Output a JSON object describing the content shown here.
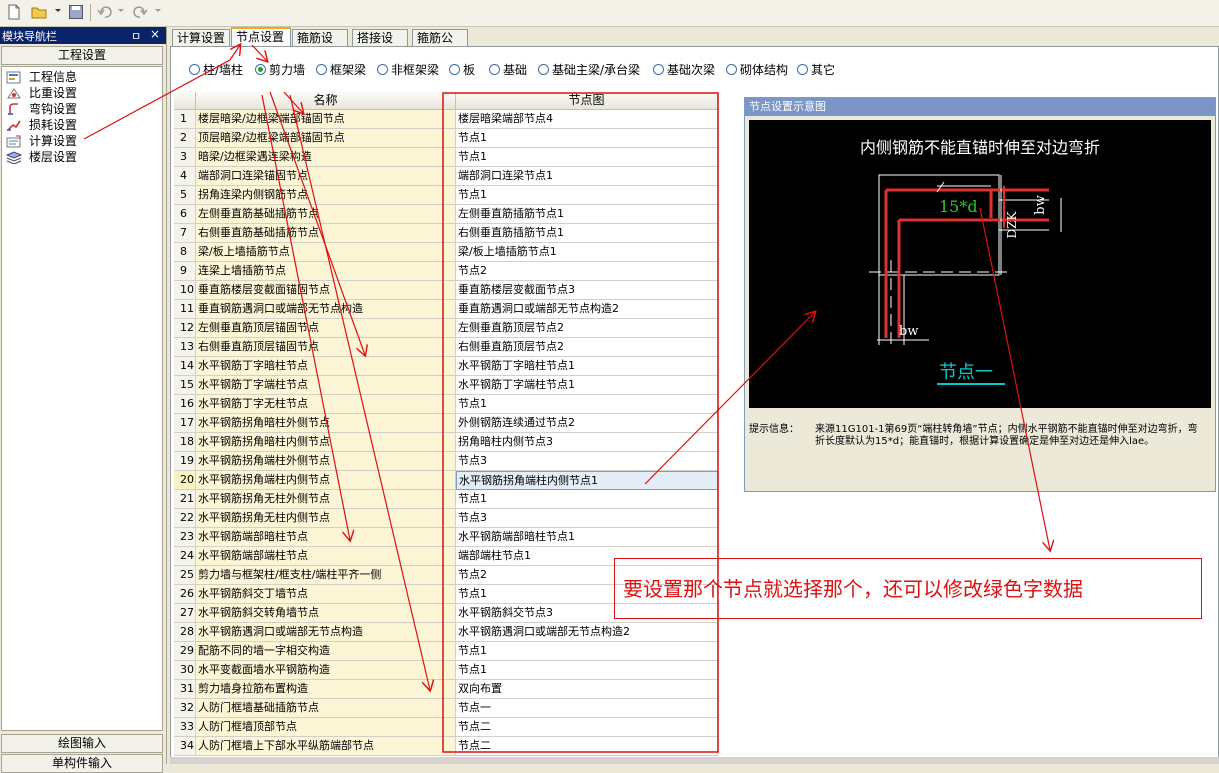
{
  "toolbar": {
    "icons": [
      "new-file-icon",
      "open-folder-icon",
      "save-icon",
      "undo-icon",
      "redo-icon"
    ]
  },
  "nav": {
    "title": "模块导航栏",
    "pin": "ㅁ",
    "close": "×",
    "top_button": "工程设置",
    "items": [
      {
        "label": "工程信息",
        "icon": "info-icon"
      },
      {
        "label": "比重设置",
        "icon": "weight-icon"
      },
      {
        "label": "弯钩设置",
        "icon": "hook-icon"
      },
      {
        "label": "损耗设置",
        "icon": "loss-icon"
      },
      {
        "label": "计算设置",
        "icon": "calc-icon"
      },
      {
        "label": "楼层设置",
        "icon": "floor-icon"
      }
    ],
    "bottom_button_1": "绘图输入",
    "bottom_button_2": "单构件输入"
  },
  "tabs": [
    {
      "label": "计算设置",
      "active": false
    },
    {
      "label": "节点设置",
      "active": true
    },
    {
      "label": "箍筋设置",
      "active": false
    },
    {
      "label": "搭接设置",
      "active": false
    },
    {
      "label": "箍筋公式",
      "active": false
    }
  ],
  "categories": [
    {
      "label": "柱/墙柱",
      "selected": false
    },
    {
      "label": "剪力墙",
      "selected": true
    },
    {
      "label": "框架梁",
      "selected": false
    },
    {
      "label": "非框架梁",
      "selected": false
    },
    {
      "label": "板",
      "selected": false
    },
    {
      "label": "基础",
      "selected": false
    },
    {
      "label": "基础主梁/承台梁",
      "selected": false
    },
    {
      "label": "基础次梁",
      "selected": false
    },
    {
      "label": "砌体结构",
      "selected": false
    },
    {
      "label": "其它",
      "selected": false
    }
  ],
  "grid": {
    "col_name": "名称",
    "col_node": "节点图",
    "selected_row": 20,
    "rows": [
      {
        "idx": "1",
        "name": "楼层暗梁/边框梁端部锚固节点",
        "node": "楼层暗梁端部节点4"
      },
      {
        "idx": "2",
        "name": "顶层暗梁/边框梁端部锚固节点",
        "node": "节点1"
      },
      {
        "idx": "3",
        "name": "暗梁/边框梁遇连梁构造",
        "node": "节点1"
      },
      {
        "idx": "4",
        "name": "端部洞口连梁锚固节点",
        "node": "端部洞口连梁节点1"
      },
      {
        "idx": "5",
        "name": "拐角连梁内侧钢筋节点",
        "node": "节点1"
      },
      {
        "idx": "6",
        "name": "左侧垂直筋基础插筋节点",
        "node": "左侧垂直筋插筋节点1"
      },
      {
        "idx": "7",
        "name": "右侧垂直筋基础插筋节点",
        "node": "右侧垂直筋插筋节点1"
      },
      {
        "idx": "8",
        "name": "梁/板上墙插筋节点",
        "node": "梁/板上墙插筋节点1"
      },
      {
        "idx": "9",
        "name": "连梁上墙插筋节点",
        "node": "节点2"
      },
      {
        "idx": "10",
        "name": "垂直筋楼层变截面锚固节点",
        "node": "垂直筋楼层变截面节点3"
      },
      {
        "idx": "11",
        "name": "垂直钢筋遇洞口或端部无节点构造",
        "node": "垂直筋遇洞口或端部无节点构造2"
      },
      {
        "idx": "12",
        "name": "左侧垂直筋顶层锚固节点",
        "node": "左侧垂直筋顶层节点2"
      },
      {
        "idx": "13",
        "name": "右侧垂直筋顶层锚固节点",
        "node": "右侧垂直筋顶层节点2"
      },
      {
        "idx": "14",
        "name": "水平钢筋丁字暗柱节点",
        "node": "水平钢筋丁字暗柱节点1"
      },
      {
        "idx": "15",
        "name": "水平钢筋丁字端柱节点",
        "node": "水平钢筋丁字端柱节点1"
      },
      {
        "idx": "16",
        "name": "水平钢筋丁字无柱节点",
        "node": "节点1"
      },
      {
        "idx": "17",
        "name": "水平钢筋拐角暗柱外侧节点",
        "node": "外侧钢筋连续通过节点2"
      },
      {
        "idx": "18",
        "name": "水平钢筋拐角暗柱内侧节点",
        "node": "拐角暗柱内侧节点3"
      },
      {
        "idx": "19",
        "name": "水平钢筋拐角端柱外侧节点",
        "node": "节点3"
      },
      {
        "idx": "20",
        "name": "水平钢筋拐角端柱内侧节点",
        "node": "水平钢筋拐角端柱内侧节点1"
      },
      {
        "idx": "21",
        "name": "水平钢筋拐角无柱外侧节点",
        "node": "节点1"
      },
      {
        "idx": "22",
        "name": "水平钢筋拐角无柱内侧节点",
        "node": "节点3"
      },
      {
        "idx": "23",
        "name": "水平钢筋端部暗柱节点",
        "node": "水平钢筋端部暗柱节点1"
      },
      {
        "idx": "24",
        "name": "水平钢筋端部端柱节点",
        "node": "端部端柱节点1"
      },
      {
        "idx": "25",
        "name": "剪力墙与框架柱/框支柱/端柱平齐一侧",
        "node": "节点2"
      },
      {
        "idx": "26",
        "name": "水平钢筋斜交丁墙节点",
        "node": "节点1"
      },
      {
        "idx": "27",
        "name": "水平钢筋斜交转角墙节点",
        "node": "水平钢筋斜交节点3"
      },
      {
        "idx": "28",
        "name": "水平钢筋遇洞口或端部无节点构造",
        "node": "水平钢筋遇洞口或端部无节点构造2"
      },
      {
        "idx": "29",
        "name": "配筋不同的墙一字相交构造",
        "node": "节点1"
      },
      {
        "idx": "30",
        "name": "水平变截面墙水平钢筋构造",
        "node": "节点1"
      },
      {
        "idx": "31",
        "name": "剪力墙身拉筋布置构造",
        "node": "双向布置"
      },
      {
        "idx": "32",
        "name": "人防门框墙基础插筋节点",
        "node": "节点一"
      },
      {
        "idx": "33",
        "name": "人防门框墙顶部节点",
        "node": "节点二"
      },
      {
        "idx": "34",
        "name": "人防门框墙上下部水平纵筋端部节点",
        "node": "节点二"
      }
    ]
  },
  "preview": {
    "title": "节点设置示意图",
    "diagram_heading": "内侧钢筋不能直锚时伸至对边弯折",
    "editable_value": "15*d",
    "label_bw_top": "bw",
    "label_bw_bottom": "bw",
    "label_dzk": "DZK",
    "node_caption": "节点一",
    "info_label": "提示信息：",
    "info_text": "来源11G101-1第69页“端柱转角墙”节点；内侧水平钢筋不能直锚时伸至对边弯折，弯折长度默认为15*d；能直锚时，根据计算设置确定是伸至对边还是伸入lae。"
  },
  "annotation": {
    "text": "要设置那个节点就选择那个，还可以修改绿色字数据"
  },
  "colors": {
    "annotation_red": "#dd1111",
    "editable_green": "#22cc22",
    "caption_cyan": "#00cccc",
    "name_column_bg": "#fdf6d6",
    "nav_title_bg": "#0a246a"
  }
}
